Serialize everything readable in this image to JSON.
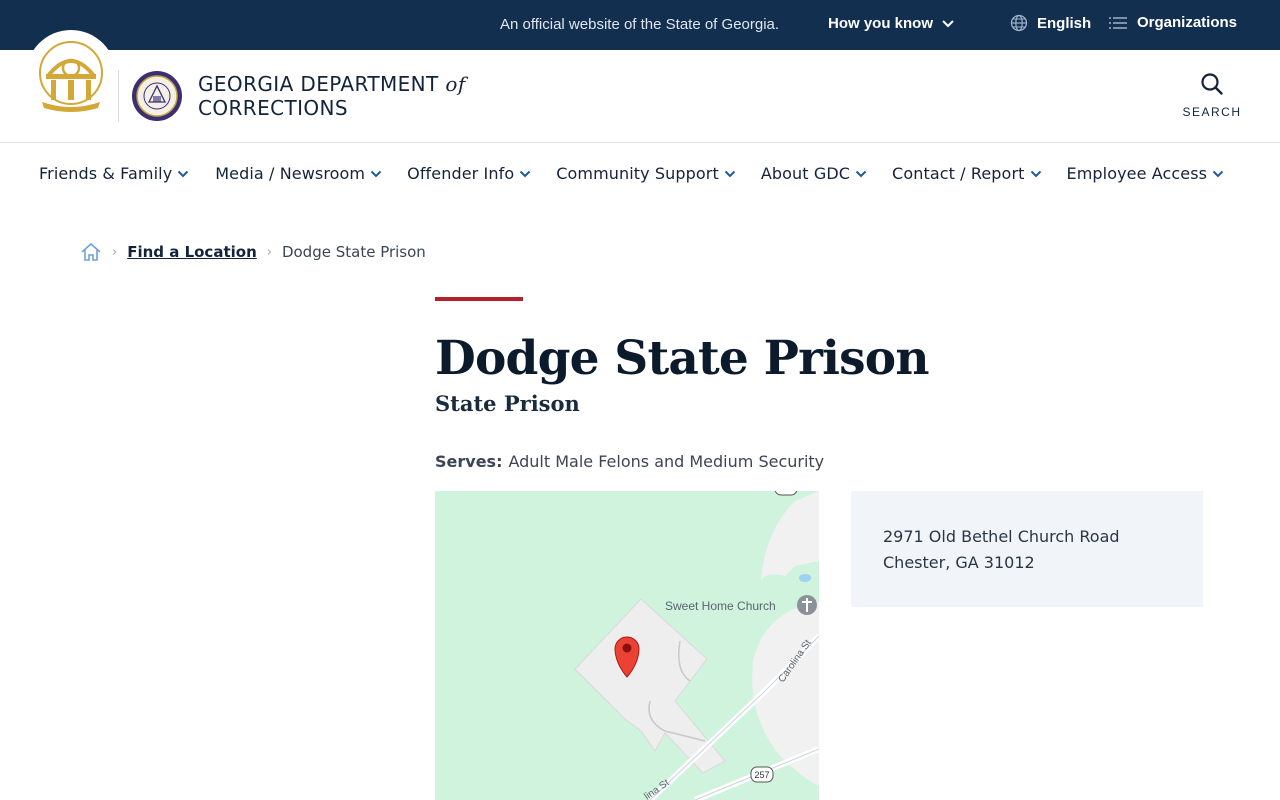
{
  "topbar": {
    "official_text": "An official website of the State of Georgia.",
    "how_you_know": "How you know",
    "language": "English",
    "organizations": "Organizations",
    "bg_color": "#132f50"
  },
  "header": {
    "org_name_line1": "GEORGIA DEPARTMENT",
    "org_name_of": "of",
    "org_name_line2": "CORRECTIONS",
    "search_label": "SEARCH"
  },
  "nav": {
    "items": [
      {
        "label": "Friends & Family"
      },
      {
        "label": "Media / Newsroom"
      },
      {
        "label": "Offender Info"
      },
      {
        "label": "Community Support"
      },
      {
        "label": "About GDC"
      },
      {
        "label": "Contact / Report"
      },
      {
        "label": "Employee Access"
      }
    ]
  },
  "breadcrumb": {
    "items": [
      {
        "label": "Find a Location"
      },
      {
        "label": "Dodge State Prison"
      }
    ]
  },
  "page": {
    "title": "Dodge State Prison",
    "subtitle": "State Prison",
    "serves_label": "Serves:",
    "serves_value": "Adult Male Felons and Medium Security",
    "accent_color": "#b3212a"
  },
  "map": {
    "church_label": "Sweet Home Church",
    "road1_label": "Carolina St",
    "road2_label": "lina St",
    "route_shield": "257"
  },
  "address": {
    "line1": "2971 Old Bethel Church Road",
    "line2": "Chester, GA 31012"
  }
}
